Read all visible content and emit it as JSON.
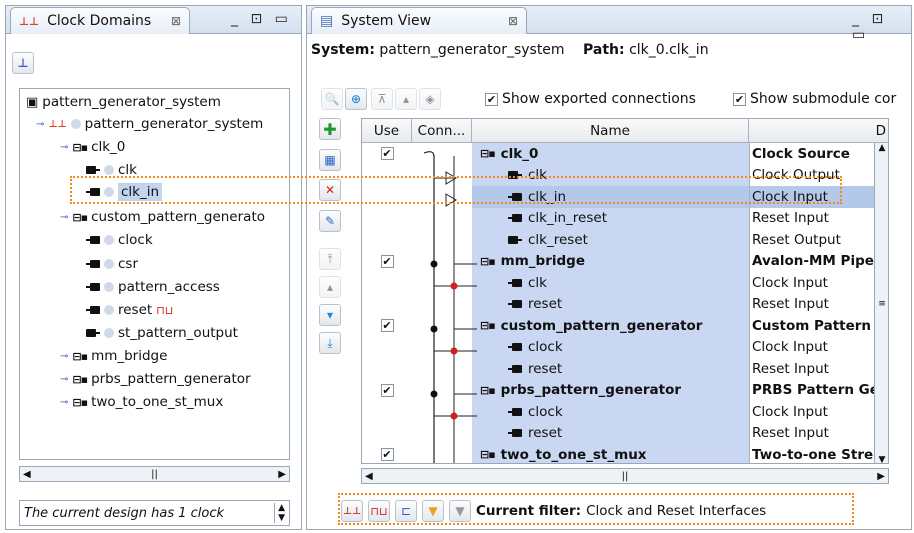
{
  "left_panel": {
    "tab_title": "Clock Domains",
    "tree": [
      {
        "label": "pattern_generator_system",
        "level": 0,
        "kind": "system"
      },
      {
        "label": "pattern_generator_system",
        "level": 1,
        "kind": "clock"
      },
      {
        "label": "clk_0",
        "level": 2,
        "kind": "module"
      },
      {
        "label": "clk",
        "level": 3,
        "kind": "out"
      },
      {
        "label": "clk_in",
        "level": 3,
        "kind": "in",
        "selected": true
      },
      {
        "label": "custom_pattern_generato",
        "level": 2,
        "kind": "module"
      },
      {
        "label": "clock",
        "level": 3,
        "kind": "in"
      },
      {
        "label": "csr",
        "level": 3,
        "kind": "in"
      },
      {
        "label": "pattern_access",
        "level": 3,
        "kind": "in"
      },
      {
        "label": "reset",
        "level": 3,
        "kind": "in",
        "reset_icon": true
      },
      {
        "label": "st_pattern_output",
        "level": 3,
        "kind": "out"
      },
      {
        "label": "mm_bridge",
        "level": 2,
        "kind": "module"
      },
      {
        "label": "prbs_pattern_generator",
        "level": 2,
        "kind": "module"
      },
      {
        "label": "two_to_one_st_mux",
        "level": 2,
        "kind": "module"
      }
    ],
    "status_text": "The current design has 1 clock"
  },
  "right_panel": {
    "tab_title": "System View",
    "system_label": "System:",
    "system_value": "pattern_generator_system",
    "path_label": "Path:",
    "path_value": "clk_0.clk_in",
    "show_exported": "Show exported connections",
    "show_submodule": "Show submodule cor",
    "columns": {
      "use": "Use",
      "conn": "Conn...",
      "name": "Name",
      "desc": "D"
    },
    "rows": [
      {
        "use": true,
        "name": "clk_0",
        "desc": "Clock Source",
        "module": true
      },
      {
        "name": "clk",
        "desc": "Clock Output",
        "kind": "out"
      },
      {
        "name": "clk_in",
        "desc": "Clock Input",
        "kind": "in",
        "selected": true
      },
      {
        "name": "clk_in_reset",
        "desc": "Reset Input",
        "kind": "in"
      },
      {
        "name": "clk_reset",
        "desc": "Reset Output",
        "kind": "out"
      },
      {
        "use": true,
        "name": "mm_bridge",
        "desc": "Avalon-MM Pipe",
        "module": true
      },
      {
        "name": "clk",
        "desc": "Clock Input",
        "kind": "in"
      },
      {
        "name": "reset",
        "desc": "Reset Input",
        "kind": "in"
      },
      {
        "use": true,
        "name": "custom_pattern_generator",
        "desc": "Custom Pattern",
        "module": true
      },
      {
        "name": "clock",
        "desc": "Clock Input",
        "kind": "in"
      },
      {
        "name": "reset",
        "desc": "Reset Input",
        "kind": "in"
      },
      {
        "use": true,
        "name": "prbs_pattern_generator",
        "desc": "PRBS Pattern Gen",
        "module": true
      },
      {
        "name": "clock",
        "desc": "Clock Input",
        "kind": "in"
      },
      {
        "name": "reset",
        "desc": "Reset Input",
        "kind": "in"
      },
      {
        "use": true,
        "name": "two_to_one_st_mux",
        "desc": "Two-to-one Stre",
        "module": true
      }
    ],
    "filter_label": "Current filter:",
    "filter_value": "Clock and Reset Interfaces"
  },
  "colors": {
    "selection": "#c2d4ee",
    "highlight": "#f08a1d",
    "blue_row": "#c9d7f2"
  }
}
